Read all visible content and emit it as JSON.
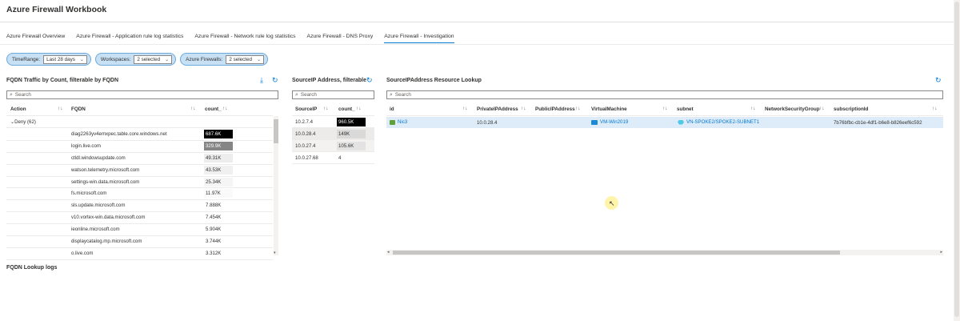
{
  "app": {
    "title": "Azure Firewall Workbook"
  },
  "tabs": [
    {
      "label": "Azure Firewall Overview",
      "active": false
    },
    {
      "label": "Azure Firewall - Application rule log statistics",
      "active": false
    },
    {
      "label": "Azure Firewall - Network rule log statistics",
      "active": false
    },
    {
      "label": "Azure Firewall - DNS Proxy",
      "active": false
    },
    {
      "label": "Azure Firewall - Investigation",
      "active": true
    }
  ],
  "params": [
    {
      "label": "TimeRange:",
      "value": "Last 28 days"
    },
    {
      "label": "Workspaces:",
      "value": "2 selected"
    },
    {
      "label": "Azure Firewalls:",
      "value": "2 selected"
    }
  ],
  "fqdn_panel": {
    "title": "FQDN Traffic by Count, filterable by FQDN",
    "search_placeholder": "Search",
    "columns": [
      "Action",
      "FQDN",
      "count_"
    ],
    "group_label": "Deny (62)",
    "rows": [
      {
        "fqdn": "diag2263yv4emxpec.table.core.windows.net",
        "count": "687.6K",
        "shade": 1.0
      },
      {
        "fqdn": "login.live.com",
        "count": "329.9K",
        "shade": 0.48
      },
      {
        "fqdn": "ctldl.windowsupdate.com",
        "count": "49.31K",
        "shade": 0.07
      },
      {
        "fqdn": "watson.telemetry.microsoft.com",
        "count": "43.53K",
        "shade": 0.06
      },
      {
        "fqdn": "settings-win.data.microsoft.com",
        "count": "25.34K",
        "shade": 0.04
      },
      {
        "fqdn": "fs.microsoft.com",
        "count": "11.97K",
        "shade": 0.02
      },
      {
        "fqdn": "sls.update.microsoft.com",
        "count": "7.888K",
        "shade": 0.01
      },
      {
        "fqdn": "v10.vortex-win.data.microsoft.com",
        "count": "7.454K",
        "shade": 0.01
      },
      {
        "fqdn": "ieonline.microsoft.com",
        "count": "5.904K",
        "shade": 0.01
      },
      {
        "fqdn": "displaycatalog.mp.microsoft.com",
        "count": "3.744K",
        "shade": 0.0
      },
      {
        "fqdn": "o.live.com",
        "count": "3.312K",
        "shade": 0.0
      }
    ]
  },
  "source_panel": {
    "title": "SourceIP Address, filterable",
    "search_placeholder": "Search",
    "columns": [
      "SourceIP",
      "count_"
    ],
    "rows": [
      {
        "ip": "10.2.7.4",
        "count": "960.5K",
        "shade": 1.0
      },
      {
        "ip": "10.0.28.4",
        "count": "149K",
        "shade": 0.15
      },
      {
        "ip": "10.0.27.4",
        "count": "105.6K",
        "shade": 0.11
      },
      {
        "ip": "10.0.27.68",
        "count": "4",
        "shade": 0.0
      }
    ]
  },
  "lookup_panel": {
    "title": "SourceIPAddress Resource Lookup",
    "search_placeholder": "Search",
    "columns": [
      "id",
      "PrivateIPAddress",
      "PublicIPAddress",
      "VirtualMachine",
      "subnet",
      "NetworkSecurityGroup",
      "subscriptionId"
    ],
    "row": {
      "id": "Nic3",
      "private_ip": "10.0.28.4",
      "public_ip": "",
      "vm": "VM-Win2019",
      "subnet": "VN-SPOKE2/SPOKE2-SUBNET1",
      "nsg": "",
      "subscription": "7b76bfbc-cb1e-4df1-b6e8-b826eef6c592"
    }
  },
  "fqdn_lookup": {
    "title": "FQDN Lookup logs"
  },
  "colors": {
    "accent": "#0078d4",
    "param_bg": "#c7e0f4",
    "selected_row": "#deecf9"
  }
}
